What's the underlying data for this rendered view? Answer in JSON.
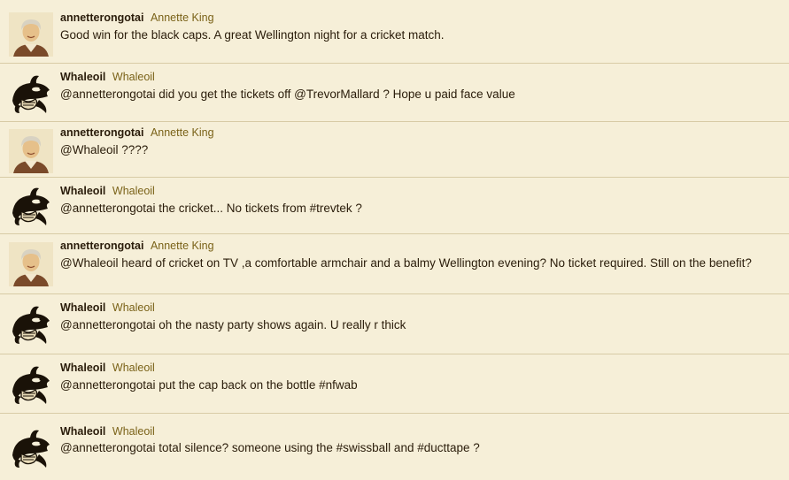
{
  "tweets": [
    {
      "screen_name": "annetterongotai",
      "full_name": "Annette King",
      "avatar": "annette-avatar-icon",
      "text": "Good win for the black caps. A great Wellington night for a cricket match."
    },
    {
      "screen_name": "Whaleoil",
      "full_name": "Whaleoil",
      "avatar": "whale-avatar-icon",
      "text": "@annetterongotai did you get the tickets off @TrevorMallard ? Hope u paid face value"
    },
    {
      "screen_name": "annetterongotai",
      "full_name": "Annette King",
      "avatar": "annette-avatar-icon",
      "text": "@Whaleoil ????"
    },
    {
      "screen_name": "Whaleoil",
      "full_name": "Whaleoil",
      "avatar": "whale-avatar-icon",
      "text": "@annetterongotai the cricket... No tickets from #trevtek ?"
    },
    {
      "screen_name": "annetterongotai",
      "full_name": "Annette King",
      "avatar": "annette-avatar-icon",
      "text": "@Whaleoil heard of cricket on TV ,a comfortable armchair and a balmy Wellington evening?   No ticket required. Still on the benefit?"
    },
    {
      "screen_name": "Whaleoil",
      "full_name": "Whaleoil",
      "avatar": "whale-avatar-icon",
      "text": "@annetterongotai oh the nasty party shows again. U really r thick"
    },
    {
      "screen_name": "Whaleoil",
      "full_name": "Whaleoil",
      "avatar": "whale-avatar-icon",
      "text": "@annetterongotai put the cap back on the bottle #nfwab"
    },
    {
      "screen_name": "Whaleoil",
      "full_name": "Whaleoil",
      "avatar": "whale-avatar-icon",
      "text": "@annetterongotai total silence? someone using the #swissball and #ducttape ?"
    }
  ]
}
